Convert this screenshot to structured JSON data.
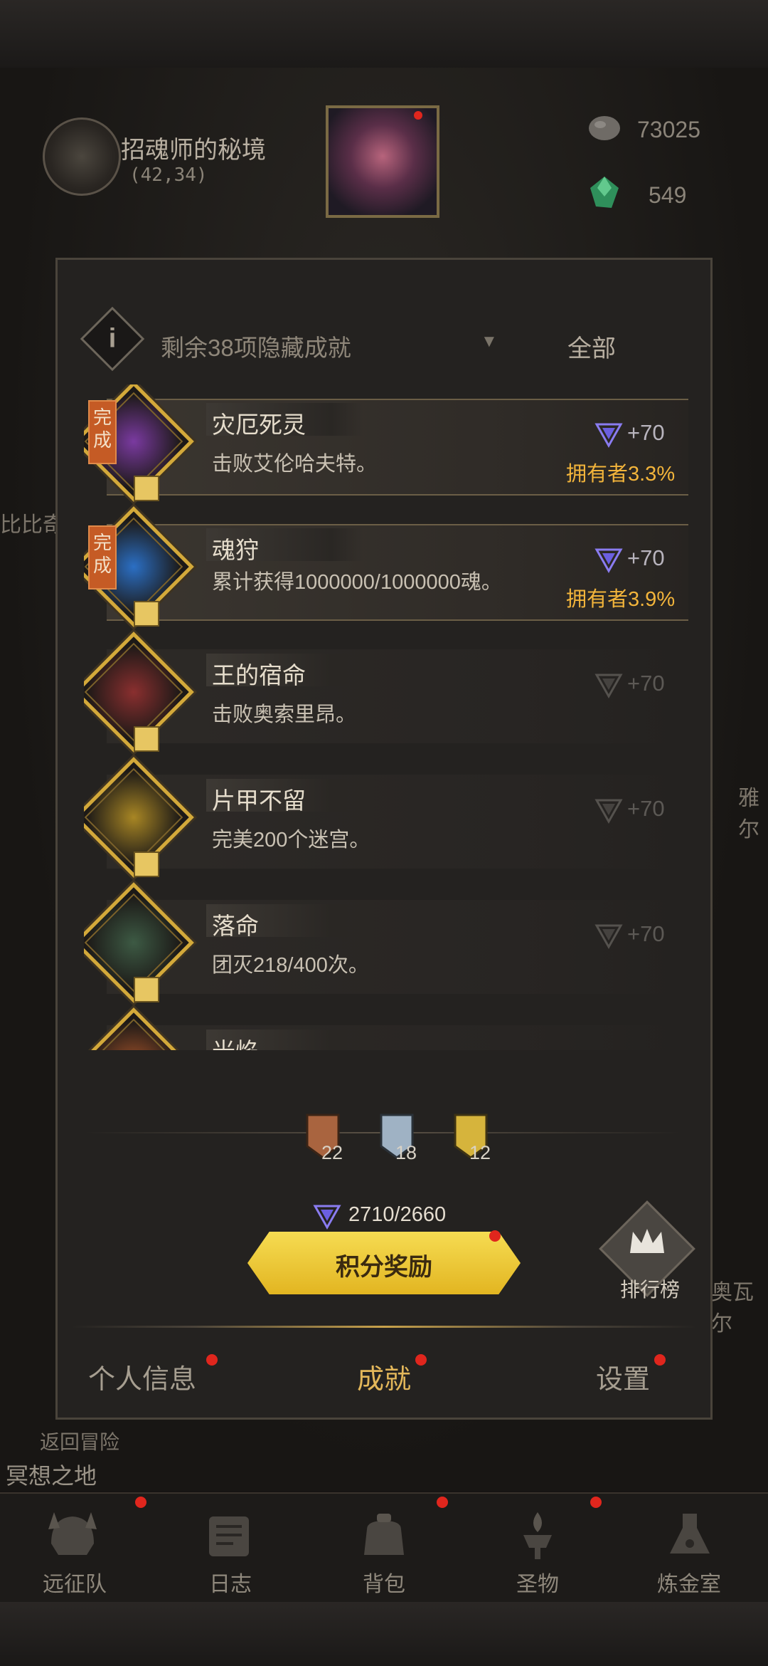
{
  "location": {
    "name": "招魂师的秘境",
    "coords": "(42,34)"
  },
  "resources": [
    {
      "icon": "stone-icon",
      "value": "73025"
    },
    {
      "icon": "green-gem-icon",
      "value": "549"
    }
  ],
  "side_labels": {
    "left_fragment": "比比奇",
    "return_label": "返回冒险",
    "area_label": "冥想之地",
    "right_fragment_1": "雅尔",
    "right_fragment_2": "奥瓦尔"
  },
  "filter": {
    "text": "剩余38项隐藏成就",
    "arrow": "▼",
    "option": "全部"
  },
  "achievements": [
    {
      "title": "灾厄死灵",
      "desc": "击败艾伦哈夫特。",
      "points": "+70",
      "owners": "拥有者3.3%",
      "done": true,
      "done_label": "完成",
      "art": "#7a3aa0"
    },
    {
      "title": "魂狩",
      "desc": "累计获得1000000/1000000魂。",
      "points": "+70",
      "owners": "拥有者3.9%",
      "done": true,
      "done_label": "完成",
      "art": "#2b6fc4"
    },
    {
      "title": "王的宿命",
      "desc": "击败奥索里昂。",
      "points": "+70",
      "owners": "",
      "done": false,
      "art": "#8a2f2f"
    },
    {
      "title": "片甲不留",
      "desc": "完美200个迷宫。",
      "points": "+70",
      "owners": "",
      "done": false,
      "art": "#a88624"
    },
    {
      "title": "落命",
      "desc": "团灭218/400次。",
      "points": "+70",
      "owners": "",
      "done": false,
      "art": "#3d5a44"
    },
    {
      "title": "光焰",
      "desc": "",
      "points": "",
      "owners": "",
      "done": false,
      "art": "#a8542a"
    }
  ],
  "medals": [
    {
      "name": "bronze",
      "count": "22",
      "color": "#a9643f"
    },
    {
      "name": "silver",
      "count": "18",
      "color": "#9fb2c4"
    },
    {
      "name": "gold",
      "count": "12",
      "color": "#d6b43c"
    }
  ],
  "score": {
    "text": "2710/2660"
  },
  "reward_button": {
    "label": "积分奖励"
  },
  "ranking": {
    "label": "排行榜"
  },
  "tabs": [
    {
      "label": "个人信息",
      "active": false
    },
    {
      "label": "成就",
      "active": true
    },
    {
      "label": "设置",
      "active": false
    }
  ],
  "nav": [
    {
      "label": "远征队",
      "icon": "helmet-icon"
    },
    {
      "label": "日志",
      "icon": "scroll-icon"
    },
    {
      "label": "背包",
      "icon": "bag-icon"
    },
    {
      "label": "圣物",
      "icon": "brazier-icon"
    },
    {
      "label": "炼金室",
      "icon": "alchemy-icon"
    }
  ]
}
